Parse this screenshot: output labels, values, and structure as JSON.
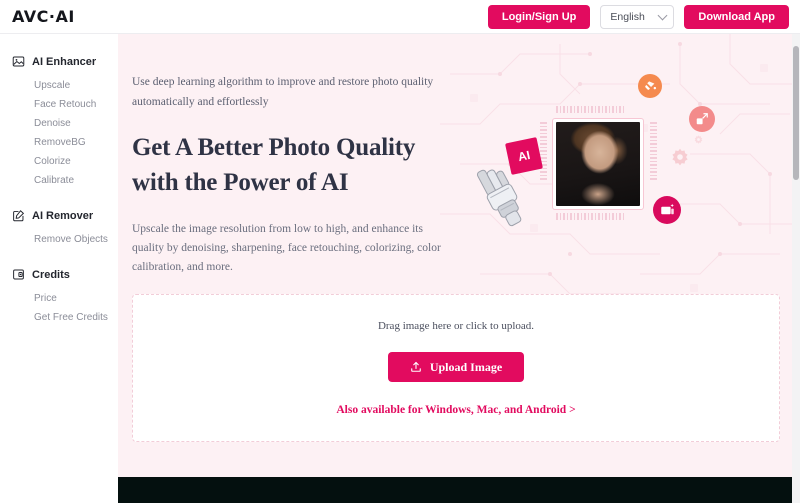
{
  "header": {
    "logo": "AVC·AI",
    "login_label": "Login/Sign Up",
    "language_value": "English",
    "language_options": [
      "English"
    ],
    "download_label": "Download App"
  },
  "sidebar": {
    "groups": [
      {
        "title": "AI Enhancer",
        "icon": "image-icon",
        "items": [
          "Upscale",
          "Face Retouch",
          "Denoise",
          "RemoveBG",
          "Colorize",
          "Calibrate"
        ]
      },
      {
        "title": "AI Remover",
        "icon": "edit-square-icon",
        "items": [
          "Remove Objects"
        ]
      },
      {
        "title": "Credits",
        "icon": "card-icon",
        "items": [
          "Price",
          "Get Free Credits"
        ]
      }
    ]
  },
  "hero": {
    "eyebrow": "Use deep learning algorithm to improve and restore photo quality automatically and effortlessly",
    "heading": "Get A Better Photo Quality with the Power of AI",
    "lead": "Upscale the image resolution from low to high, and enhance its quality by denoising, sharpening, face retouching, colorizing, color calibration, and more.",
    "art": {
      "ai_card_label": "AI",
      "badges": [
        "paint-bucket-icon",
        "resize-icon",
        "image-enhance-icon"
      ],
      "decorations": [
        "circuit-board-background",
        "gear-icon",
        "robot-hand-image",
        "portrait-photo"
      ]
    }
  },
  "upload": {
    "drag_text": "Drag image here or click to upload.",
    "button_label": "Upload Image",
    "button_icon": "upload-icon",
    "also_available": "Also available for Windows, Mac, and Android >"
  },
  "colors": {
    "accent": "#e20b5f",
    "accent_dark": "#d90a5d",
    "page_bg": "#fdf1f4",
    "footer_bg": "#04100f",
    "badge_orange": "#f58a4e",
    "badge_salmon": "#f38b8b",
    "text_dark": "#2f3345",
    "text_muted": "#8b8d98"
  }
}
